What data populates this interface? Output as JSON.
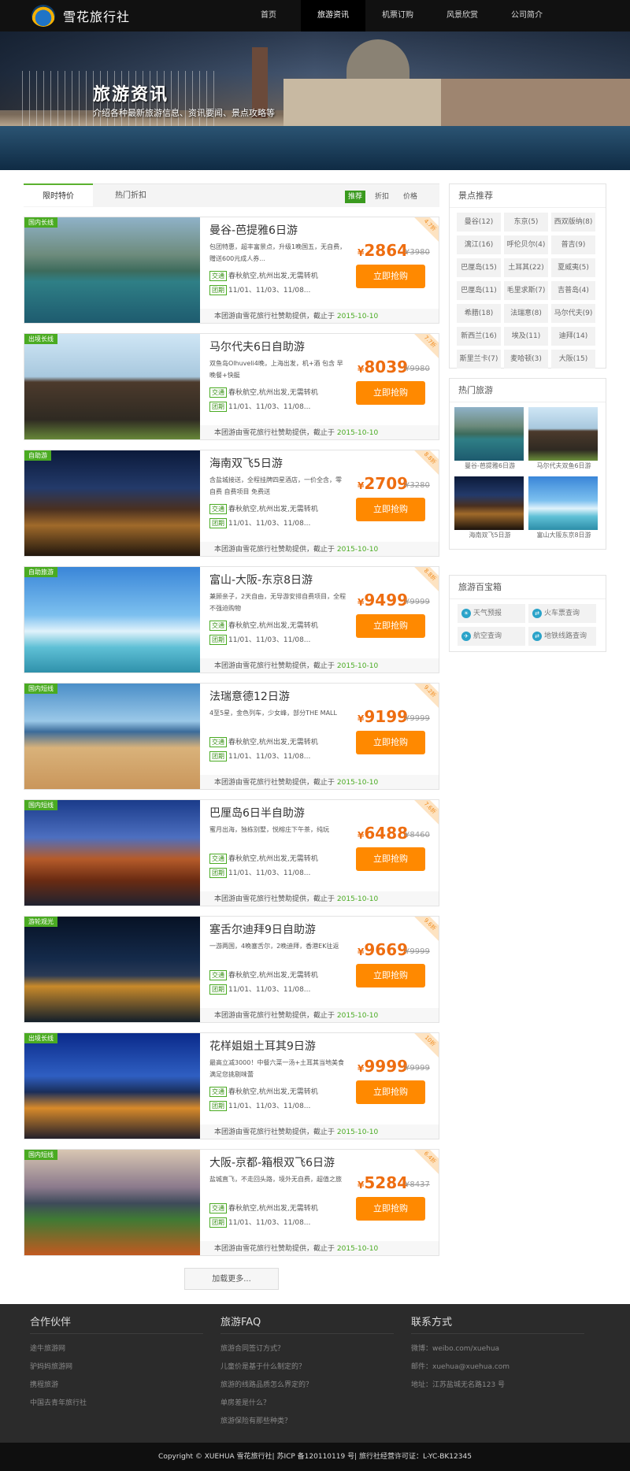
{
  "site": {
    "name": "雪花旅行社"
  },
  "nav": [
    {
      "label": "首页"
    },
    {
      "label": "旅游资讯",
      "active": true
    },
    {
      "label": "机票订购"
    },
    {
      "label": "风景欣赏"
    },
    {
      "label": "公司简介"
    }
  ],
  "banner": {
    "title": "旅游资讯",
    "subtitle": "介绍各种最新旅游信息、资讯要闻、景点攻略等"
  },
  "tabs": {
    "t1": "限时特价",
    "t2": "热门折扣"
  },
  "filters": {
    "f1": "推荐",
    "f2": "折扣",
    "f3": "价格"
  },
  "products": [
    {
      "badge": "国内长线",
      "title": "曼谷-芭提雅6日游",
      "desc": "包团特惠，超丰富景点，升级1晚国五，无自费，赠送600元成人券...",
      "price": "2864",
      "old": "¥3980",
      "discount": "4.7折",
      "transport": "春秋航空,杭州出发,无需转机",
      "dates": "11/01、11/03、11/08...",
      "provider": "本团游由雪花旅行社赞助提供，截止于",
      "deadline": "2015-10-10"
    },
    {
      "badge": "出境长线",
      "title": "马尔代夫6日自助游",
      "desc": "双鱼岛Olhuveli4晚，上海出发，机+酒 包含 早晚餐+快艇",
      "price": "8039",
      "old": "¥9980",
      "discount": "7.7折",
      "transport": "春秋航空,杭州出发,无需转机",
      "dates": "11/01、11/03、11/08...",
      "provider": "本团游由雪花旅行社赞助提供，截止于",
      "deadline": "2015-10-10"
    },
    {
      "badge": "自助游",
      "title": "海南双飞5日游",
      "desc": "含盐城接送，全程挂牌四星酒店，一价全含，零自费 自费项目 免费送",
      "price": "2709",
      "old": "¥3280",
      "discount": "8.8折",
      "transport": "春秋航空,杭州出发,无需转机",
      "dates": "11/01、11/03、11/08...",
      "provider": "本团游由雪花旅行社赞助提供，截止于",
      "deadline": "2015-10-10"
    },
    {
      "badge": "自助旅游",
      "title": "富山-大阪-东京8日游",
      "desc": "兼顾亲子，2天自由，无导游安排自费项目，全程不强迫购物",
      "price": "9499",
      "old": "¥9999",
      "discount": "8.8折",
      "transport": "春秋航空,杭州出发,无需转机",
      "dates": "11/01、11/03、11/08...",
      "provider": "本团游由雪花旅行社赞助提供，截止于",
      "deadline": "2015-10-10"
    },
    {
      "badge": "国内短线",
      "title": "法瑞意德12日游",
      "desc": "4至5星，金色列车，少女峰，部分THE MALL",
      "price": "9199",
      "old": "¥9999",
      "discount": "9.2折",
      "transport": "春秋航空,杭州出发,无需转机",
      "dates": "11/01、11/03、11/08...",
      "provider": "本团游由雪花旅行社赞助提供，截止于",
      "deadline": "2015-10-10"
    },
    {
      "badge": "国内短线",
      "title": "巴厘岛6日半自助游",
      "desc": "蜜月出海，独栋别墅，悦榕庄下午茶，纯玩",
      "price": "6488",
      "old": "¥8460",
      "discount": "7.6折",
      "transport": "春秋航空,杭州出发,无需转机",
      "dates": "11/01、11/03、11/08...",
      "provider": "本团游由雪花旅行社赞助提供，截止于",
      "deadline": "2015-10-10"
    },
    {
      "badge": "游轮观光",
      "title": "塞舌尔迪拜9日自助游",
      "desc": "一游两国，4晚塞舌尔，2晚迪拜，香港EK往返",
      "price": "9669",
      "old": "¥9999",
      "discount": "9.6折",
      "transport": "春秋航空,杭州出发,无需转机",
      "dates": "11/01、11/03、11/08...",
      "provider": "本团游由雪花旅行社赞助提供，截止于",
      "deadline": "2015-10-10"
    },
    {
      "badge": "出境长线",
      "title": "花样姐姐土耳其9日游",
      "desc": "最高立减3000！中餐六菜一汤+土耳其当地美食 满足您挑剔味蕾",
      "price": "9999",
      "old": "¥9999",
      "discount": "10折",
      "transport": "春秋航空,杭州出发,无需转机",
      "dates": "11/01、11/03、11/08...",
      "provider": "本团游由雪花旅行社赞助提供，截止于",
      "deadline": "2015-10-10"
    },
    {
      "badge": "国内短线",
      "title": "大阪-京都-箱根双飞6日游",
      "desc": "盐城直飞，不走回头路，境外无自费，超值之旅",
      "price": "5284",
      "old": "¥8437",
      "discount": "6.4折",
      "transport": "春秋航空,杭州出发,无需转机",
      "dates": "11/01、11/03、11/08...",
      "provider": "本团游由雪花旅行社赞助提供，截止于",
      "deadline": "2015-10-10"
    }
  ],
  "labels": {
    "transport_tag": "交通",
    "group_tag": "团期",
    "buy": "立即抢购",
    "yen": "¥",
    "more": "加载更多..."
  },
  "sidebar": {
    "spots_title": "景点推荐",
    "spots": [
      "曼谷(12)",
      "东京(5)",
      "西双版纳(8)",
      "漓江(16)",
      "呼伦贝尔(4)",
      "普吉(9)",
      "巴厘岛(15)",
      "土耳其(22)",
      "夏威夷(5)",
      "巴厘岛(11)",
      "毛里求斯(7)",
      "吉普岛(4)",
      "希腊(18)",
      "法瑞意(8)",
      "马尔代夫(9)",
      "新西兰(16)",
      "埃及(11)",
      "迪拜(14)",
      "斯里兰卡(7)",
      "麦哈顿(3)",
      "大阪(15)"
    ],
    "hot_title": "热门旅游",
    "hot": [
      "曼谷-芭提雅6日游",
      "马尔代夫双鱼6日游",
      "海南双飞5日游",
      "富山大阪东京8日游"
    ],
    "tools_title": "旅游百宝箱",
    "tools": [
      "天气预报",
      "火车票查询",
      "航空查询",
      "地铁线路查询"
    ]
  },
  "footer": {
    "partners_title": "合作伙伴",
    "partners": [
      "途牛旅游网",
      "驴妈妈旅游网",
      "携程旅游",
      "中国去青年旅行社"
    ],
    "faq_title": "旅游FAQ",
    "faq": [
      "旅游合同签订方式？",
      "儿童价是基于什么制定的？",
      "旅游的线路品质怎么界定的？",
      "单房差是什么？",
      "旅游保险有那些种类？"
    ],
    "contact_title": "联系方式",
    "contact": [
      "微博：weibo.com/xuehua",
      "邮件：xuehua@xuehua.com",
      "地址：江苏盐城无名路123 号"
    ],
    "copyright": "Copyright © XUEHUA 雪花旅行社| 苏ICP 备120110119 号| 旅行社经营许可证：L-YC-BK12345"
  },
  "colors": {
    "accent": "#ff8900",
    "green": "#4aab22",
    "price": "#ee6d10",
    "dark": "#111111"
  }
}
